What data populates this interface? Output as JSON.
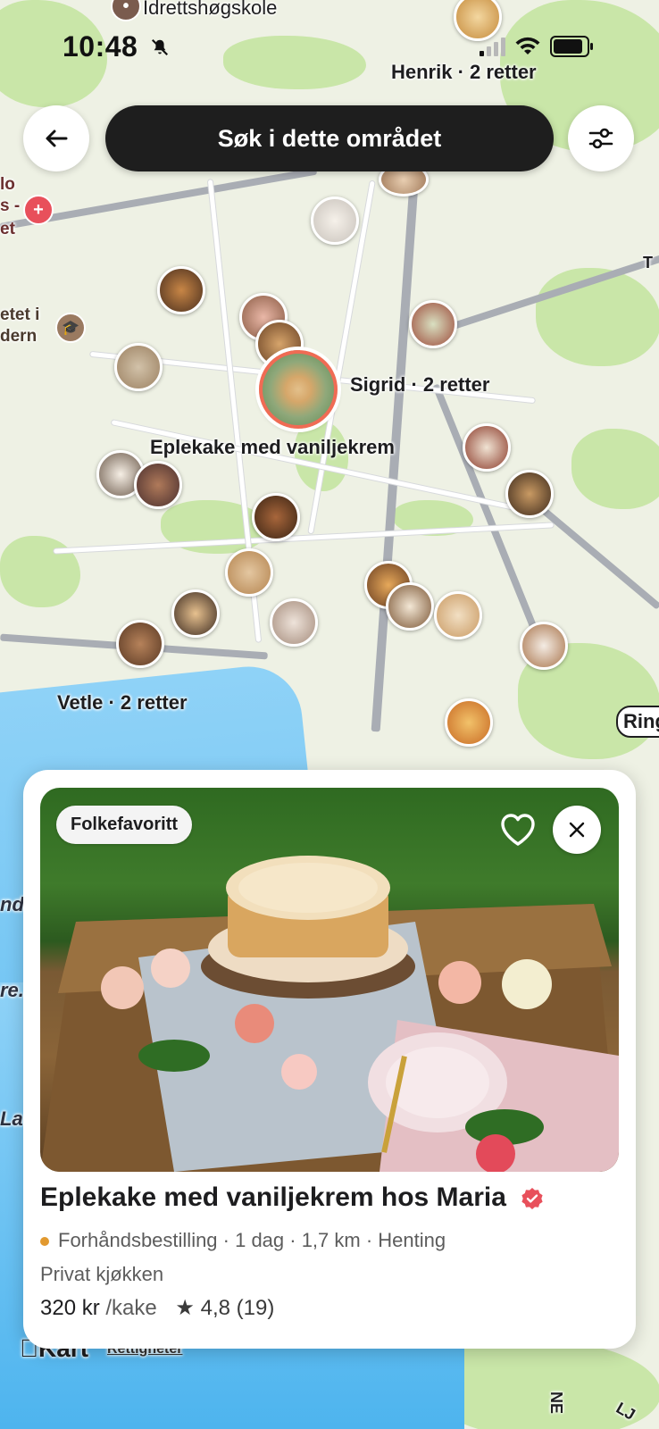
{
  "status_bar": {
    "time": "10:48"
  },
  "map": {
    "labels": {
      "idrett": "Idrettshøgskole",
      "henrik": "Henrik · 2 retter",
      "sigrid": "Sigrid · 2 retter",
      "eplekake": "Eplekake med vaniljekrem",
      "vetle": "Vetle · 2 retter",
      "ring": "Ring",
      "edge_lo": "lo",
      "edge_s": "s -",
      "edge_et": "et",
      "edge_etet": "etet i",
      "edge_dern": "dern",
      "edge_t": "T",
      "edge_nd": "nd",
      "edge_re": "re.",
      "edge_la": "La",
      "attribution_brand": "Kart",
      "attribution_legal": "Rettigheter",
      "edge_ne": "NE",
      "edge_lj": "LJ"
    }
  },
  "top_controls": {
    "search_area_label": "Søk i dette området"
  },
  "card": {
    "badge": "Folkefavoritt",
    "title": "Eplekake med vaniljekrem hos Maria",
    "availability": "Forhåndsbestilling · 1 dag · 1,7 km · Henting",
    "kitchen": "Privat kjøkken",
    "price": "320 kr",
    "unit": "/kake",
    "rating": "★ 4,8 (19)"
  },
  "colors": {
    "search_button_bg": "#1e1e1e",
    "availability_dot": "#e2992f",
    "verified_badge": "#e8505b",
    "selected_pin_ring": "#f06b54"
  }
}
